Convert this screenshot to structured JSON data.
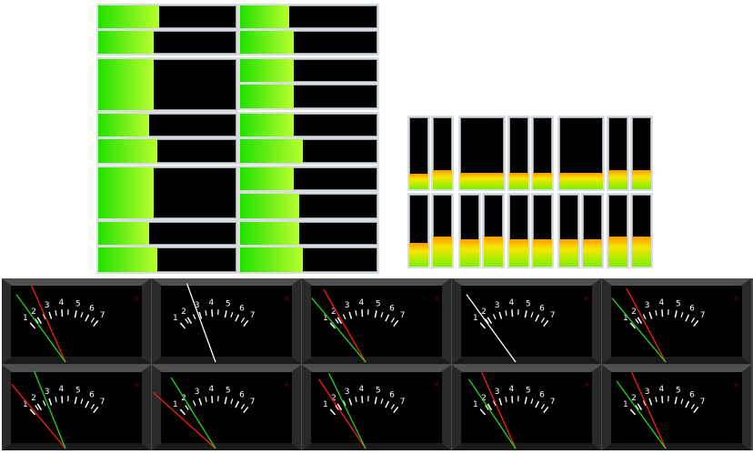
{
  "colors": {
    "background": "#ffffff",
    "bar_track": "#000000",
    "bar_border": "#d9dde2",
    "horizontal_fill_start": "#22e000",
    "horizontal_fill_end": "#b8ff2c",
    "vertical_fill_top": "#ff9a00",
    "vertical_fill_mid": "#f7e600",
    "vertical_fill_bottom": "#7cf000",
    "meter_face": "#000000",
    "meter_bezel_light": "#6a6a6a",
    "meter_bezel_dark": "#2a2a2a",
    "meter_scale": "#ffffff",
    "needle_left": "#ff1a1a",
    "needle_right": "#1fd61f",
    "needle_mono": "#ffffff",
    "peak_led": "#3a0000"
  },
  "horizontal_level_meters": {
    "left_column_levels": [
      0.44,
      0.4,
      0.4,
      0.37,
      0.43,
      0.4,
      0.37,
      0.43
    ],
    "right_column_levels": [
      0.36,
      0.39,
      0.39,
      0.39,
      0.39,
      0.46,
      0.39,
      0.43,
      0.43,
      0.46
    ]
  },
  "vertical_level_meters": {
    "top_row_levels": [
      0.22,
      0.27,
      0.23,
      0.23,
      0.23,
      0.23,
      0.23,
      0.23,
      0.27,
      0.27
    ],
    "bottom_row_levels": [
      0.33,
      0.42,
      0.38,
      0.42,
      0.38,
      0.38,
      0.38,
      0.38,
      0.42,
      0.42
    ]
  },
  "vu_meters": {
    "scale_labels": [
      "1",
      "2",
      "3",
      "4",
      "5",
      "6",
      "7"
    ],
    "meters": [
      {
        "needles": [
          {
            "color": "needle_left",
            "angle_deg": -24
          },
          {
            "color": "needle_right",
            "angle_deg": -36
          }
        ]
      },
      {
        "needles": [
          {
            "color": "needle_mono",
            "angle_deg": -20
          }
        ]
      },
      {
        "needles": [
          {
            "color": "needle_left",
            "angle_deg": -30
          },
          {
            "color": "needle_right",
            "angle_deg": -40
          }
        ]
      },
      {
        "needles": [
          {
            "color": "needle_mono",
            "angle_deg": -36
          }
        ]
      },
      {
        "needles": [
          {
            "color": "needle_left",
            "angle_deg": -28
          },
          {
            "color": "needle_right",
            "angle_deg": -40
          }
        ]
      },
      {
        "needles": [
          {
            "color": "needle_left",
            "angle_deg": -40
          },
          {
            "color": "needle_right",
            "angle_deg": -22
          }
        ]
      },
      {
        "needles": [
          {
            "color": "needle_left",
            "angle_deg": -48
          },
          {
            "color": "needle_right",
            "angle_deg": -32
          }
        ]
      },
      {
        "needles": [
          {
            "color": "needle_left",
            "angle_deg": -34
          },
          {
            "color": "needle_right",
            "angle_deg": -26
          }
        ]
      },
      {
        "needles": [
          {
            "color": "needle_left",
            "angle_deg": -24
          },
          {
            "color": "needle_right",
            "angle_deg": -34
          }
        ]
      },
      {
        "needles": [
          {
            "color": "needle_left",
            "angle_deg": -24
          },
          {
            "color": "needle_right",
            "angle_deg": -36
          }
        ]
      }
    ]
  }
}
